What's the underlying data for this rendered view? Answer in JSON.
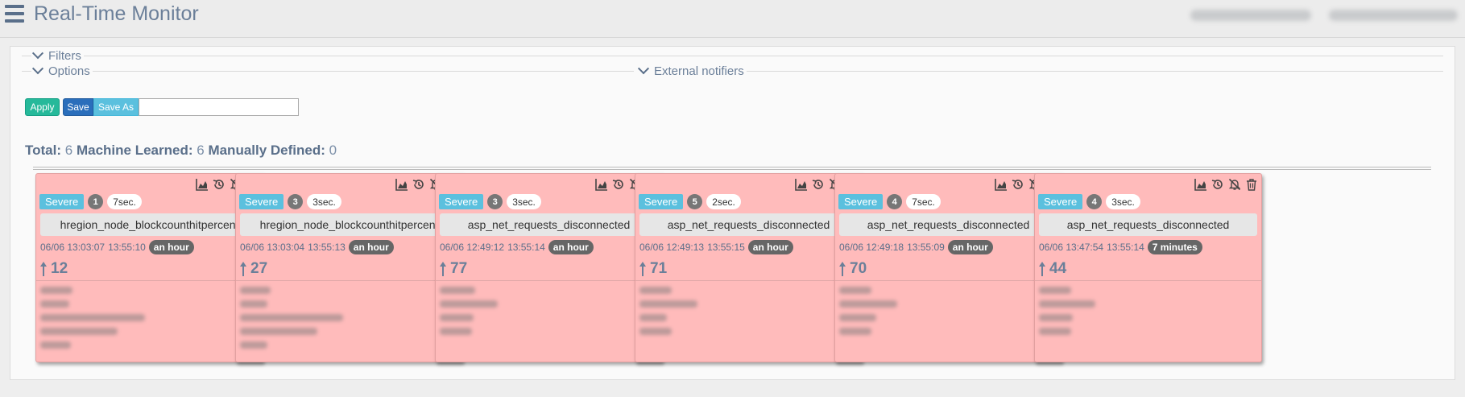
{
  "app": {
    "title": "Real-Time Monitor"
  },
  "sections": {
    "filters": "Filters",
    "options": "Options",
    "external_notifiers": "External notifiers"
  },
  "toolbar": {
    "apply_label": "Apply",
    "save_label": "Save",
    "save_as_label": "Save As",
    "name_value": ""
  },
  "totals": {
    "total_label": "Total:",
    "total_value": "6",
    "ml_label": "Machine Learned:",
    "ml_value": "6",
    "md_label": "Manually Defined:",
    "md_value": "0"
  },
  "colors": {
    "card_bg": "#ffbbbb",
    "severity": "#5bc0de",
    "apply": "#26b99a",
    "save": "#2a6ebb"
  },
  "card_icons": [
    "chart-area-icon",
    "history-icon",
    "bell-slash-icon",
    "trash-icon"
  ],
  "cards": [
    {
      "severity": "Severe",
      "count": "1",
      "age": "7sec.",
      "metric": "hregion_node_blockcounthitpercent",
      "start": "06/06 13:03:07",
      "end": "13:55:10",
      "duration": "an hour",
      "value": "12"
    },
    {
      "severity": "Severe",
      "count": "3",
      "age": "3sec.",
      "metric": "hregion_node_blockcounthitpercent",
      "start": "06/06 13:03:04",
      "end": "13:55:13",
      "duration": "an hour",
      "value": "27"
    },
    {
      "severity": "Severe",
      "count": "3",
      "age": "3sec.",
      "metric": "asp_net_requests_disconnected",
      "start": "06/06 12:49:12",
      "end": "13:55:14",
      "duration": "an hour",
      "value": "77"
    },
    {
      "severity": "Severe",
      "count": "5",
      "age": "2sec.",
      "metric": "asp_net_requests_disconnected",
      "start": "06/06 12:49:13",
      "end": "13:55:15",
      "duration": "an hour",
      "value": "71"
    },
    {
      "severity": "Severe",
      "count": "4",
      "age": "7sec.",
      "metric": "asp_net_requests_disconnected",
      "start": "06/06 12:49:18",
      "end": "13:55:09",
      "duration": "an hour",
      "value": "70"
    },
    {
      "severity": "Severe",
      "count": "4",
      "age": "3sec.",
      "metric": "asp_net_requests_disconnected",
      "start": "06/06 13:47:54",
      "end": "13:55:14",
      "duration": "7 minutes",
      "value": "44"
    }
  ]
}
